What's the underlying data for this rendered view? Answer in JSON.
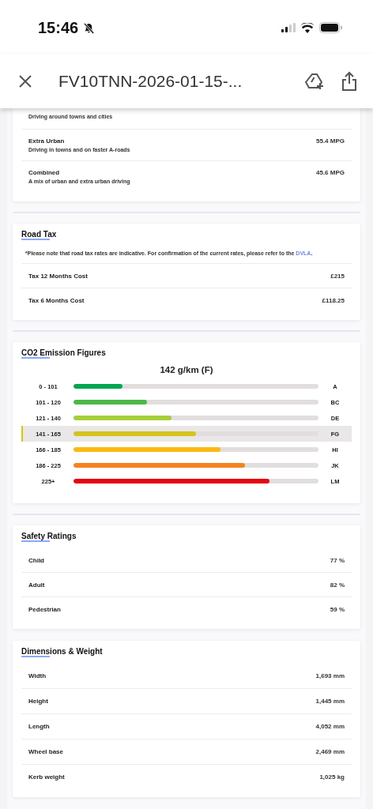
{
  "status_bar": {
    "time": "15:46"
  },
  "toolbar": {
    "title": "FV10TNN-2026-01-15-..."
  },
  "fuel_economy": {
    "first_row_subtitle": "Driving around towns and cities",
    "rows": [
      {
        "label": "Extra Urban",
        "subtitle": "Driving in towns and on faster A-roads",
        "value": "55.4 MPG"
      },
      {
        "label": "Combined",
        "subtitle": "A mix of urban and extra urban driving",
        "value": "45.6 MPG"
      }
    ]
  },
  "road_tax": {
    "title": "Road Tax",
    "note": "*Please note that road tax rates are indicative. For confirmation of the current rates, please refer to the",
    "link": "DVLA",
    "note_end": ".",
    "rows": [
      {
        "label": "Tax 12 Months Cost",
        "value": "£215"
      },
      {
        "label": "Tax 6 Months Cost",
        "value": "£118.25"
      }
    ]
  },
  "co2": {
    "title": "CO2 Emission Figures",
    "reading": "142 g/km (F)",
    "bands": [
      {
        "range": "0 - 101",
        "band": "A",
        "level": 0.2,
        "color": "#00a651",
        "selected": false
      },
      {
        "range": "101 - 120",
        "band": "BC",
        "level": 0.3,
        "color": "#4cb848",
        "selected": false
      },
      {
        "range": "121 - 140",
        "band": "DE",
        "level": 0.4,
        "color": "#a6ce39",
        "selected": false
      },
      {
        "range": "141 - 165",
        "band": "FG",
        "level": 0.5,
        "color": "#d4c41c",
        "selected": true
      },
      {
        "range": "166 - 185",
        "band": "HI",
        "level": 0.6,
        "color": "#fdb913",
        "selected": false
      },
      {
        "range": "186 - 225",
        "band": "JK",
        "level": 0.7,
        "color": "#f58220",
        "selected": false
      },
      {
        "range": "225+",
        "band": "LM",
        "level": 0.8,
        "color": "#e30613",
        "selected": false
      }
    ]
  },
  "safety_ratings": {
    "title": "Safety Ratings",
    "rows": [
      {
        "label": "Child",
        "value": "77 %"
      },
      {
        "label": "Adult",
        "value": "82 %"
      },
      {
        "label": "Pedestrian",
        "value": "59 %"
      }
    ]
  },
  "dimensions": {
    "title": "Dimensions & Weight",
    "rows": [
      {
        "label": "Width",
        "value": "1,693 mm"
      },
      {
        "label": "Height",
        "value": "1,445 mm"
      },
      {
        "label": "Length",
        "value": "4,052 mm"
      },
      {
        "label": "Wheel base",
        "value": "2,469 mm"
      },
      {
        "label": "Kerb weight",
        "value": "1,025 kg"
      }
    ]
  }
}
